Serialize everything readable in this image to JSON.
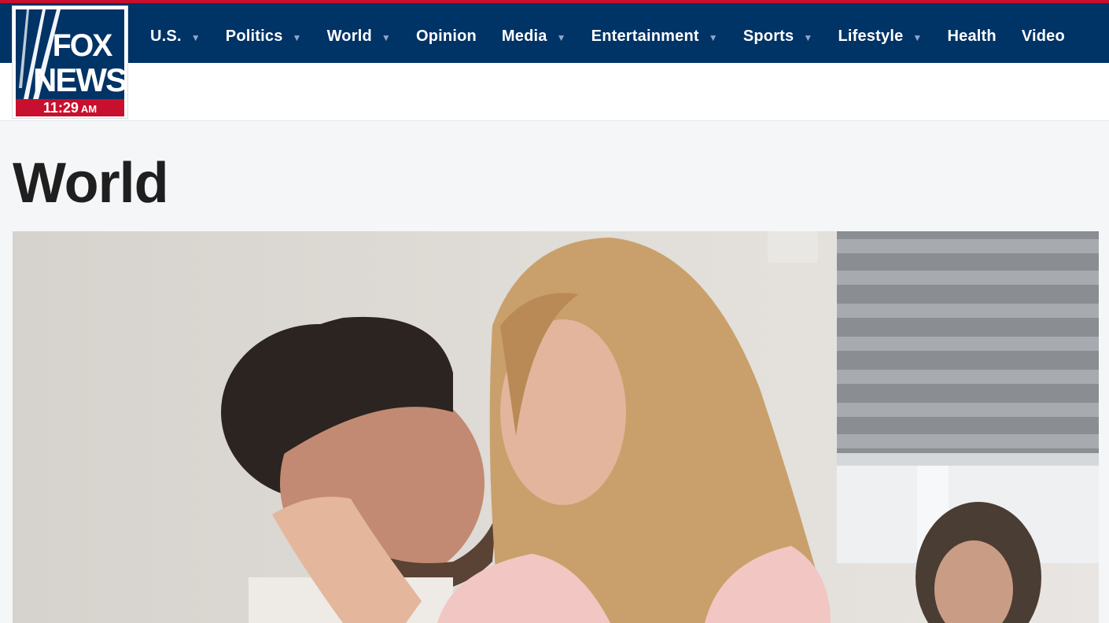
{
  "header": {
    "logo": {
      "line1": "FOX",
      "line2": "NEWS",
      "time": "11:29",
      "ampm": "AM"
    },
    "nav": [
      {
        "label": "U.S.",
        "dropdown": true
      },
      {
        "label": "Politics",
        "dropdown": true
      },
      {
        "label": "World",
        "dropdown": true
      },
      {
        "label": "Opinion",
        "dropdown": false
      },
      {
        "label": "Media",
        "dropdown": true
      },
      {
        "label": "Entertainment",
        "dropdown": true
      },
      {
        "label": "Sports",
        "dropdown": true
      },
      {
        "label": "Lifestyle",
        "dropdown": true
      },
      {
        "label": "Health",
        "dropdown": false
      },
      {
        "label": "Video",
        "dropdown": false
      }
    ]
  },
  "page": {
    "title": "World"
  },
  "colors": {
    "navy": "#003366",
    "red": "#c8102e",
    "background": "#f5f6f8"
  },
  "icons": {
    "dropdown": "caret-down-icon"
  }
}
